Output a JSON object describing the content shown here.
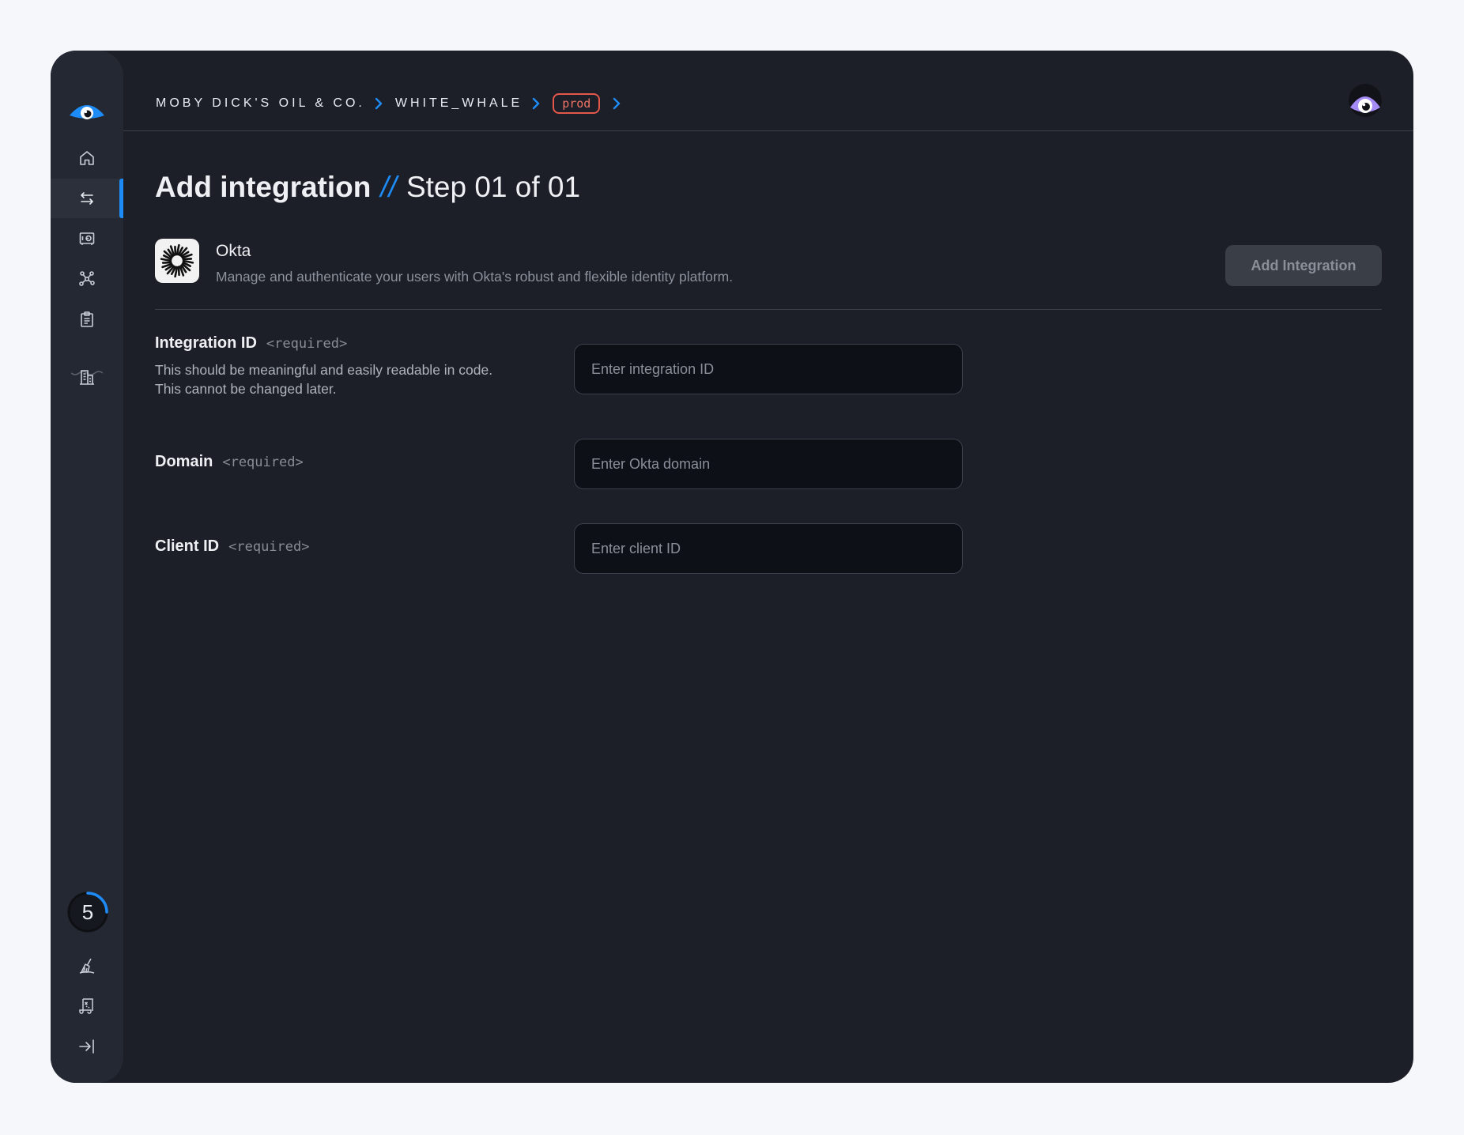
{
  "breadcrumb": {
    "org": "MOBY DICK'S OIL & CO.",
    "project": "WHITE_WHALE",
    "environment": "prod"
  },
  "sidebar": {
    "items": [
      {
        "icon": "home-icon"
      },
      {
        "icon": "arrows-exchange-icon",
        "active": true
      },
      {
        "icon": "vault-icon"
      },
      {
        "icon": "network-nodes-icon"
      },
      {
        "icon": "clipboard-icon"
      },
      {
        "icon": "buildings-icon"
      }
    ],
    "badge_count": "5",
    "bottom_items": [
      {
        "icon": "broom-icon"
      },
      {
        "icon": "scroll-map-icon"
      },
      {
        "icon": "collapse-sidebar-icon"
      }
    ]
  },
  "page": {
    "title": "Add integration",
    "separator": "//",
    "step": "Step 01 of 01"
  },
  "integration": {
    "name": "Okta",
    "description": "Manage and authenticate your users with Okta's robust and flexible identity platform.",
    "add_button": "Add Integration"
  },
  "form": {
    "required_tag": "<required>",
    "integration_id": {
      "label": "Integration ID",
      "hint_line1": "This should be meaningful and easily readable in code.",
      "hint_line2": "This cannot be changed later.",
      "placeholder": "Enter integration ID"
    },
    "domain": {
      "label": "Domain",
      "placeholder": "Enter Okta domain"
    },
    "client_id": {
      "label": "Client ID",
      "placeholder": "Enter client ID"
    }
  },
  "colors": {
    "accent": "#1d8cf8",
    "env_badge": "#e4574b",
    "background": "#1c1f27",
    "sidebar": "#242832"
  }
}
